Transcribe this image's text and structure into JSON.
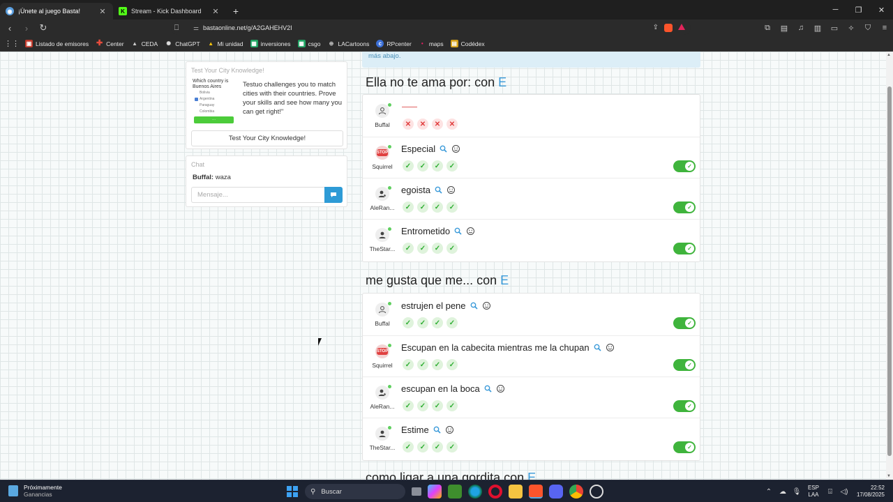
{
  "browser": {
    "tabs": [
      {
        "title": "¡Únete al juego Basta!",
        "active": true
      },
      {
        "title": "Stream - Kick Dashboard",
        "active": false
      }
    ],
    "url": "bastaonline.net/g/A2GAHEHV2I",
    "bookmarks": [
      "Listado de emisores",
      "Center",
      "CEDA",
      "ChatGPT",
      "Mi unidad",
      "inversiones",
      "csgo",
      "LACartoons",
      "RPcenter",
      "maps",
      "Codédex"
    ]
  },
  "colors": {
    "accent": "#3a9ad9",
    "ok": "#2fae33",
    "error": "#e03b3b",
    "toggle": "#3fb43c",
    "chat_send": "#2e9bd6"
  },
  "promo": {
    "title": "Test Your City Knowledge!",
    "thumb_question": "Which country is Buenos Aires",
    "thumb_options": [
      "Bolivia",
      "Argentina",
      "Paraguay",
      "Colombia"
    ],
    "description": "Testuo challenges you to match cities with their countries. Prove your skills and see how many you can get right!\"",
    "button": "Test Your City Knowledge!"
  },
  "chat": {
    "title": "Chat",
    "last_message": {
      "user": "Buffal:",
      "text": "waza"
    },
    "placeholder": "Mensaje..."
  },
  "info_text": "más abajo.",
  "categories": [
    {
      "title": "Ella no te ama por: con",
      "letter": "E",
      "answers": [
        {
          "user": "Buffal",
          "answer": "",
          "avatar": "person-icon",
          "marks": [
            "x",
            "x",
            "x",
            "x"
          ],
          "approved": false
        },
        {
          "user": "Squirrel",
          "answer": "Especial",
          "avatar": "stop-icon",
          "marks": [
            "ok",
            "ok",
            "ok",
            "ok"
          ],
          "approved": true
        },
        {
          "user": "AleRan...",
          "answer": "egoista",
          "avatar": "person-star-icon",
          "marks": [
            "ok",
            "ok",
            "ok",
            "ok"
          ],
          "approved": true
        },
        {
          "user": "TheStar...",
          "answer": "Entrometido",
          "avatar": "person-icon",
          "marks": [
            "ok",
            "ok",
            "ok",
            "ok"
          ],
          "approved": true
        }
      ]
    },
    {
      "title": "me gusta que me... con",
      "letter": "E",
      "answers": [
        {
          "user": "Buffal",
          "answer": "estrujen el pene",
          "avatar": "person-icon",
          "marks": [
            "ok",
            "ok",
            "ok",
            "ok"
          ],
          "approved": true
        },
        {
          "user": "Squirrel",
          "answer": "Escupan en la cabecita mientras me la chupan",
          "avatar": "stop-icon",
          "marks": [
            "ok",
            "ok",
            "ok",
            "ok"
          ],
          "approved": true
        },
        {
          "user": "AleRan...",
          "answer": "escupan en la boca",
          "avatar": "person-star-icon",
          "marks": [
            "ok",
            "ok",
            "ok",
            "ok"
          ],
          "approved": true
        },
        {
          "user": "TheStar...",
          "answer": "Estime",
          "avatar": "person-icon",
          "marks": [
            "ok",
            "ok",
            "ok",
            "ok"
          ],
          "approved": true
        }
      ]
    },
    {
      "title": "como ligar a una gordita con",
      "letter": "E",
      "answers": []
    }
  ],
  "taskbar": {
    "weather_title": "Próximamente",
    "weather_sub": "Ganancias",
    "search": "Buscar",
    "lang1": "ESP",
    "lang2": "LAA",
    "time": "22:52",
    "date": "17/08/2025"
  }
}
